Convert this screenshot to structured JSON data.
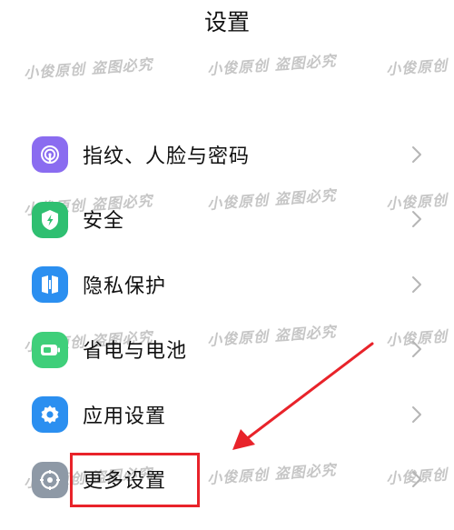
{
  "header": {
    "title": "设置"
  },
  "settings": {
    "items": [
      {
        "label": "指纹、人脸与密码",
        "icon": "fingerprint-icon",
        "color": "#8a6cf0"
      },
      {
        "label": "安全",
        "icon": "shield-icon",
        "color": "#2fbf71"
      },
      {
        "label": "隐私保护",
        "icon": "privacy-icon",
        "color": "#2b8ff0"
      },
      {
        "label": "省电与电池",
        "icon": "battery-icon",
        "color": "#3fcf7a"
      },
      {
        "label": "应用设置",
        "icon": "gear-icon",
        "color": "#2b8ff0"
      },
      {
        "label": "更多设置",
        "icon": "more-settings-icon",
        "color": "#8e99a6"
      }
    ]
  },
  "watermark": {
    "text": "小俊原创 盗图必究"
  },
  "annotation": {
    "color": "#e8232a"
  }
}
